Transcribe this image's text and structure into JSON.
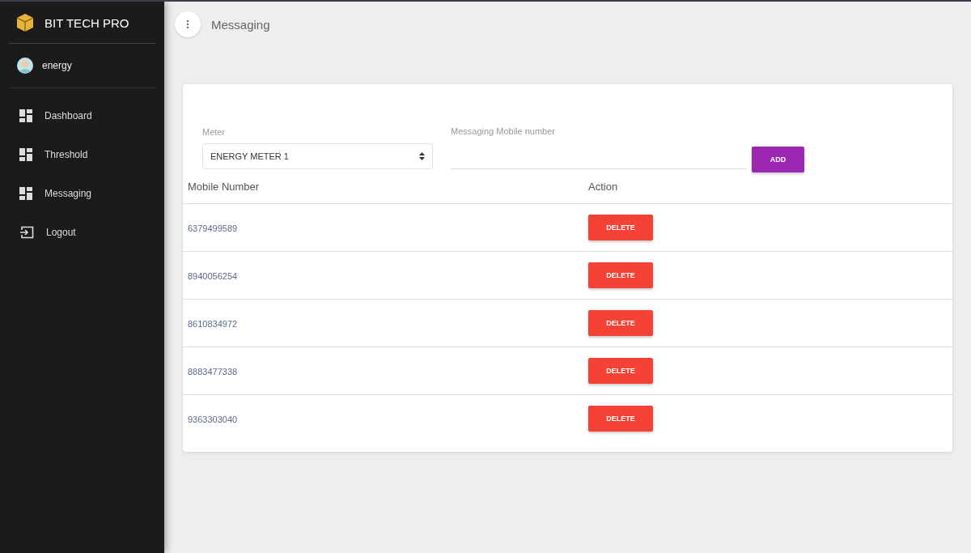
{
  "sidebar": {
    "brand": "BIT TECH PRO",
    "user": "energy",
    "items": [
      {
        "label": "Dashboard",
        "kind": "grid"
      },
      {
        "label": "Threshold",
        "kind": "grid"
      },
      {
        "label": "Messaging",
        "kind": "grid"
      },
      {
        "label": "Logout",
        "kind": "exit"
      }
    ]
  },
  "header": {
    "title": "Messaging"
  },
  "form": {
    "meter_label": "Meter",
    "meter_value": "ENERGY METER 1",
    "mobile_label": "Messaging Mobile number",
    "add_button": "ADD"
  },
  "table": {
    "columns": [
      "Mobile Number",
      "Action"
    ],
    "rows": [
      {
        "number": "6379499589",
        "action": "DELETE"
      },
      {
        "number": "8940056254",
        "action": "DELETE"
      },
      {
        "number": "8610834972",
        "action": "DELETE"
      },
      {
        "number": "8883477338",
        "action": "DELETE"
      },
      {
        "number": "9363303040",
        "action": "DELETE"
      }
    ]
  }
}
